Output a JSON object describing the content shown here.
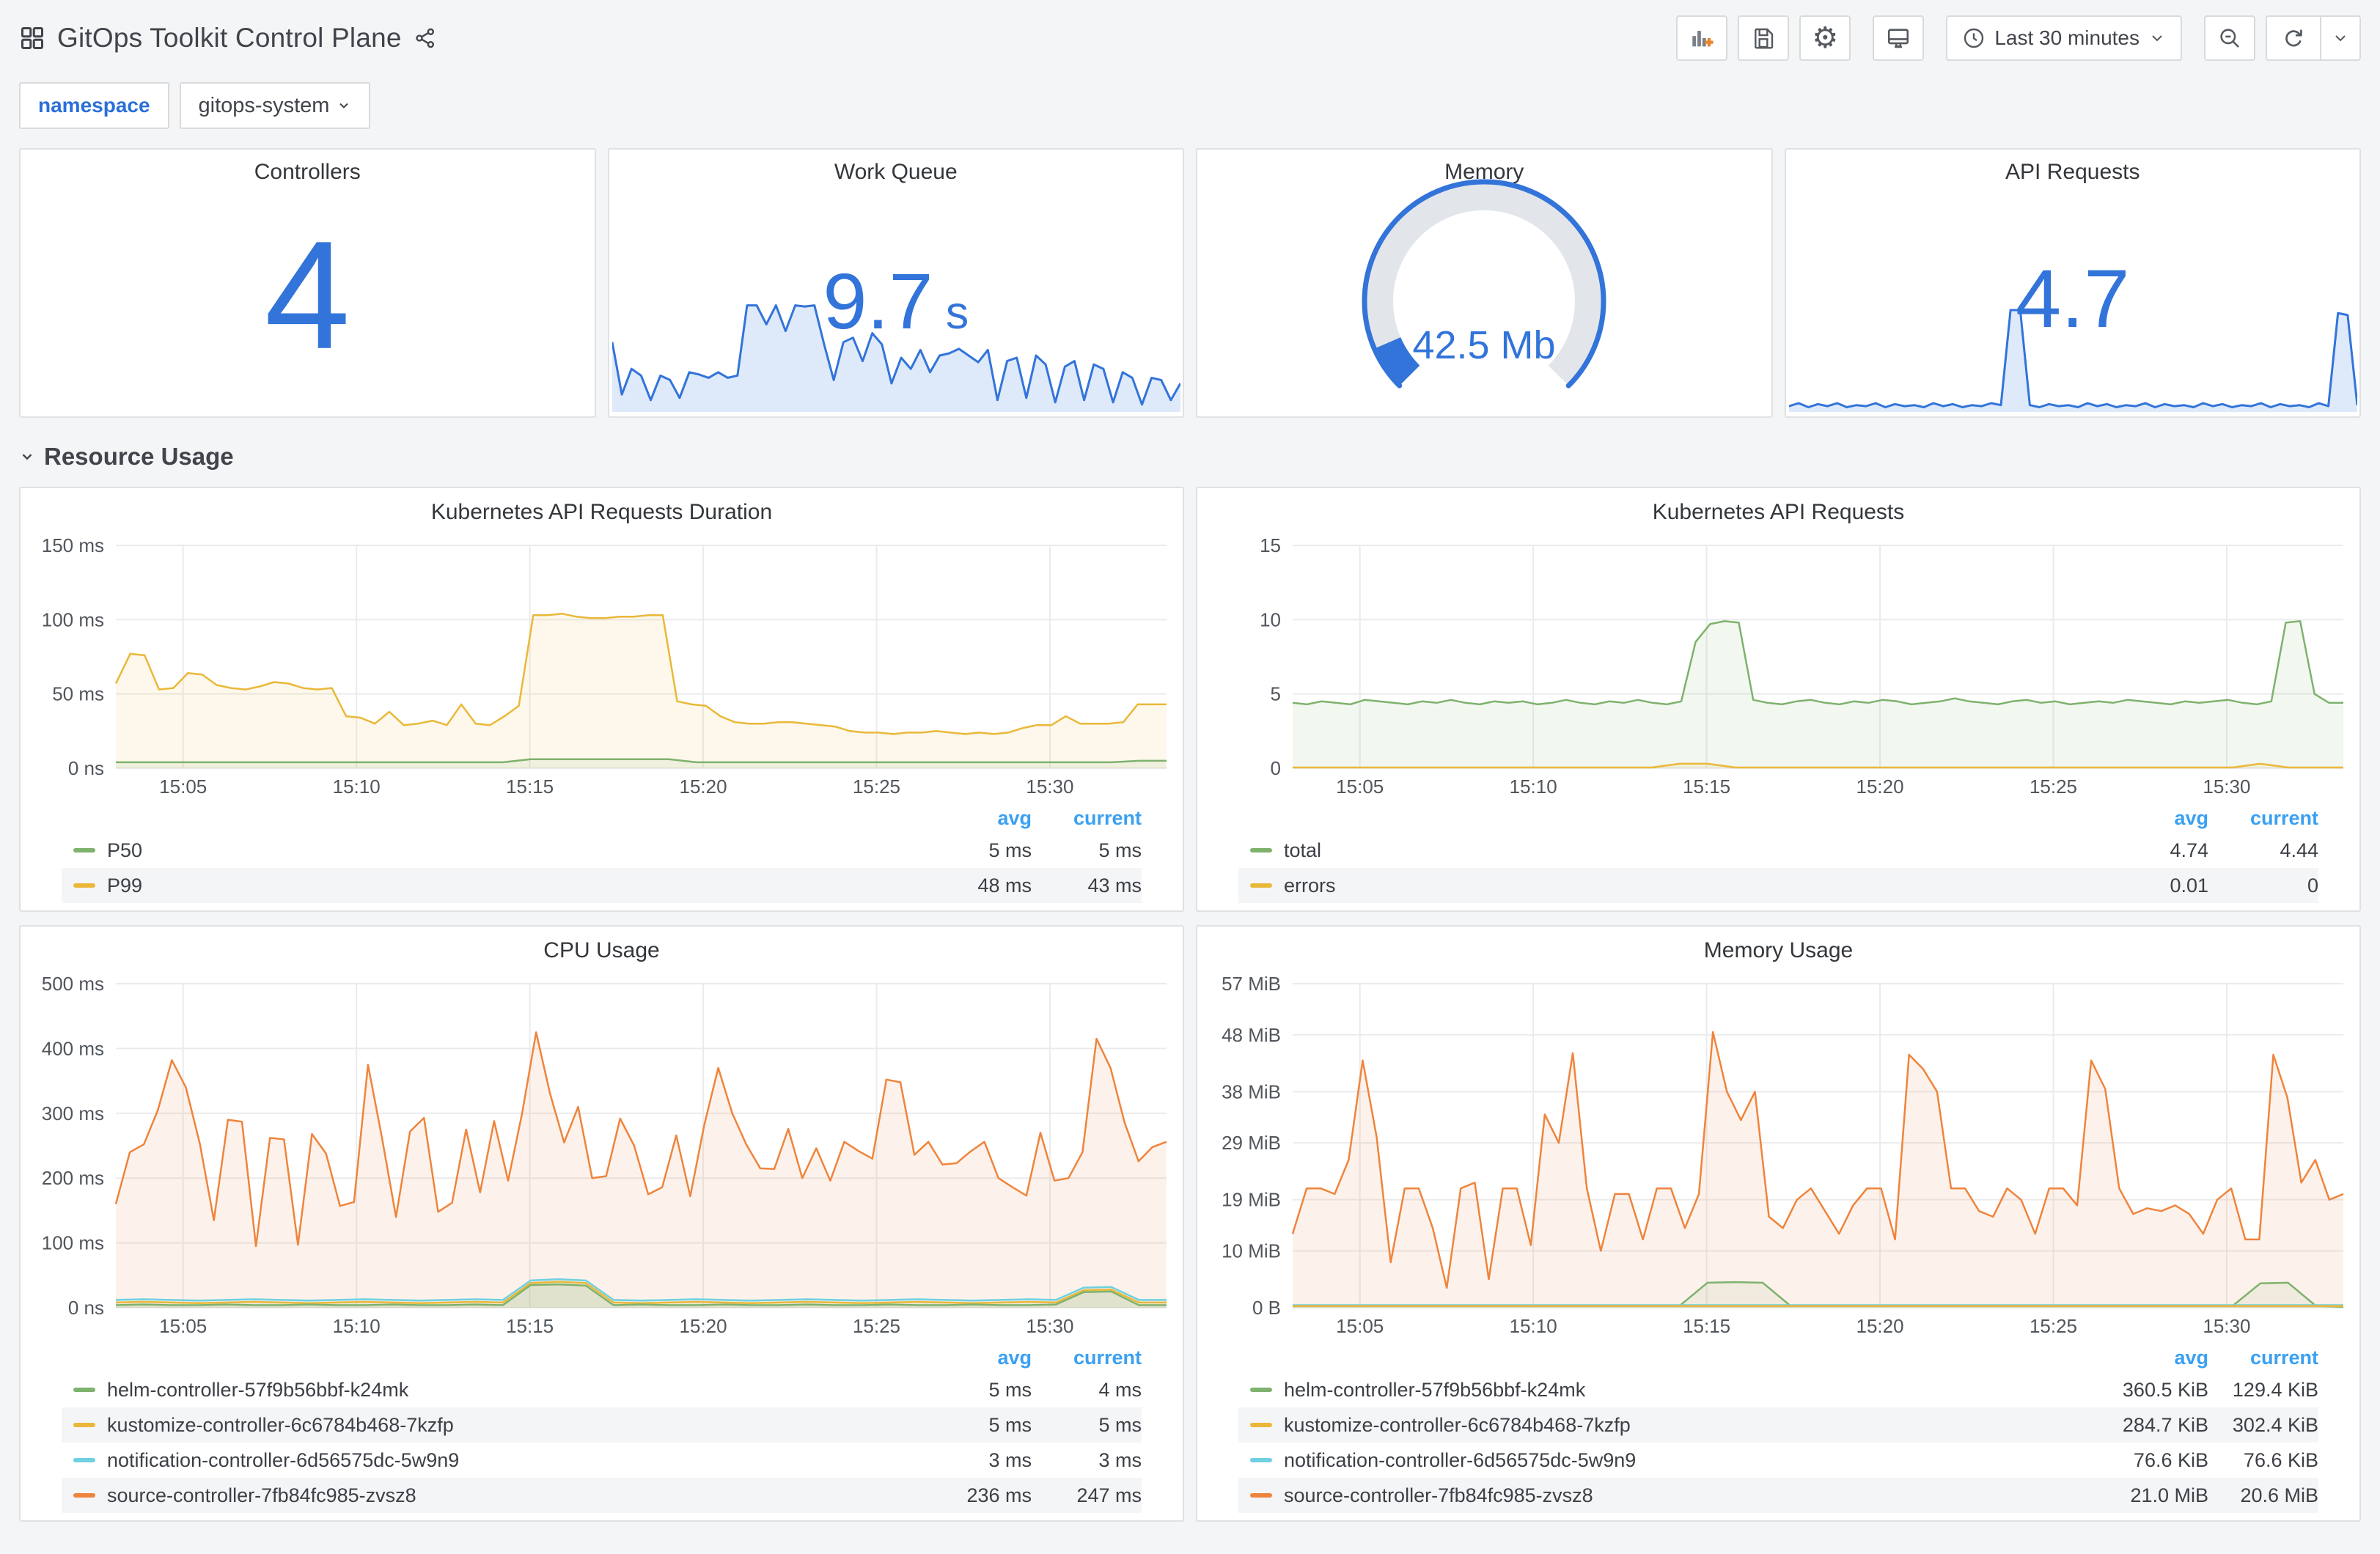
{
  "header": {
    "title": "GitOps Toolkit Control Plane",
    "time_range": "Last 30 minutes"
  },
  "toolbar": {
    "icons": [
      "add-panel",
      "save-dashboard",
      "dashboard-settings",
      "cycle-view-mode",
      "time-range",
      "zoom-out",
      "refresh",
      "refresh-interval"
    ]
  },
  "variables": {
    "label": "namespace",
    "value": "gitops-system"
  },
  "section": {
    "title": "Resource Usage"
  },
  "colors": {
    "blue": "#3274D9",
    "green": "#7EB26D",
    "yellow": "#EAB839",
    "lightblue": "#6ED0E0",
    "orange": "#EF843C"
  },
  "stats": [
    {
      "title": "Controllers",
      "value": "4"
    },
    {
      "title": "Work Queue",
      "value": "9.7",
      "suffix": " s",
      "spark": [
        0.62,
        0.15,
        0.38,
        0.32,
        0.1,
        0.32,
        0.28,
        0.12,
        0.35,
        0.33,
        0.3,
        0.35,
        0.3,
        0.32,
        0.95,
        0.95,
        0.78,
        0.95,
        0.72,
        0.95,
        0.94,
        0.95,
        0.6,
        0.28,
        0.62,
        0.66,
        0.45,
        0.7,
        0.6,
        0.25,
        0.48,
        0.38,
        0.55,
        0.35,
        0.5,
        0.52,
        0.56,
        0.5,
        0.44,
        0.55,
        0.1,
        0.45,
        0.48,
        0.12,
        0.5,
        0.42,
        0.08,
        0.4,
        0.45,
        0.1,
        0.42,
        0.38,
        0.08,
        0.35,
        0.3,
        0.06,
        0.3,
        0.28,
        0.1,
        0.25
      ]
    },
    {
      "title": "Memory",
      "value": "42.5 Mb",
      "gauge_fraction": 0.08
    },
    {
      "title": "API Requests",
      "value": "4.7",
      "spark": [
        0.05,
        0.08,
        0.04,
        0.07,
        0.05,
        0.08,
        0.04,
        0.06,
        0.05,
        0.08,
        0.04,
        0.07,
        0.05,
        0.06,
        0.04,
        0.08,
        0.05,
        0.07,
        0.04,
        0.06,
        0.05,
        0.08,
        0.06,
        1.0,
        1.0,
        0.06,
        0.04,
        0.07,
        0.05,
        0.06,
        0.04,
        0.08,
        0.05,
        0.07,
        0.04,
        0.06,
        0.05,
        0.08,
        0.04,
        0.07,
        0.05,
        0.06,
        0.04,
        0.08,
        0.05,
        0.07,
        0.04,
        0.06,
        0.05,
        0.08,
        0.04,
        0.07,
        0.05,
        0.06,
        0.04,
        0.08,
        0.05,
        0.97,
        0.95,
        0.06
      ]
    }
  ],
  "legend_cols": [
    "avg",
    "current"
  ],
  "chart_data": [
    {
      "type": "area",
      "title": "Kubernetes API Requests Duration",
      "ymax": 150,
      "yticks": [
        {
          "v": 0,
          "label": "0 ns"
        },
        {
          "v": 50,
          "label": "50 ms"
        },
        {
          "v": 100,
          "label": "100 ms"
        },
        {
          "v": 150,
          "label": "150 ms"
        }
      ],
      "xticks": [
        {
          "f": 0.064,
          "label": "15:05"
        },
        {
          "f": 0.229,
          "label": "15:10"
        },
        {
          "f": 0.394,
          "label": "15:15"
        },
        {
          "f": 0.559,
          "label": "15:20"
        },
        {
          "f": 0.724,
          "label": "15:25"
        },
        {
          "f": 0.889,
          "label": "15:30"
        }
      ],
      "series": [
        {
          "name": "P50",
          "color": "#7EB26D",
          "avg": "5 ms",
          "current": "5 ms",
          "values": [
            4,
            4,
            4,
            4,
            4,
            4,
            4,
            4,
            4,
            4,
            4,
            4,
            4,
            4,
            4,
            6,
            6,
            6,
            6,
            6,
            6,
            4,
            4,
            4,
            4,
            4,
            4,
            4,
            4,
            4,
            4,
            4,
            4,
            4,
            4,
            4,
            4,
            5,
            5
          ]
        },
        {
          "name": "P99",
          "color": "#EAB839",
          "avg": "48 ms",
          "current": "43 ms",
          "values": [
            57,
            77,
            76,
            53,
            54,
            64,
            63,
            56,
            54,
            53,
            55,
            58,
            57,
            54,
            53,
            54,
            35,
            34,
            30,
            38,
            29,
            30,
            32,
            29,
            43,
            30,
            29,
            35,
            42,
            103,
            103,
            104,
            102,
            101,
            101,
            102,
            102,
            103,
            103,
            45,
            43,
            42,
            35,
            31,
            30,
            30,
            31,
            31,
            30,
            29,
            28,
            25,
            24,
            24,
            23,
            24,
            24,
            25,
            24,
            23,
            24,
            23,
            24,
            27,
            29,
            29,
            35,
            30,
            30,
            30,
            31,
            43,
            43,
            43
          ]
        }
      ]
    },
    {
      "type": "area",
      "title": "Kubernetes API Requests",
      "ymax": 15,
      "yticks": [
        {
          "v": 0,
          "label": "0"
        },
        {
          "v": 5,
          "label": "5"
        },
        {
          "v": 10,
          "label": "10"
        },
        {
          "v": 15,
          "label": "15"
        }
      ],
      "xticks": [
        {
          "f": 0.064,
          "label": "15:05"
        },
        {
          "f": 0.229,
          "label": "15:10"
        },
        {
          "f": 0.394,
          "label": "15:15"
        },
        {
          "f": 0.559,
          "label": "15:20"
        },
        {
          "f": 0.724,
          "label": "15:25"
        },
        {
          "f": 0.889,
          "label": "15:30"
        }
      ],
      "series": [
        {
          "name": "total",
          "color": "#7EB26D",
          "avg": "4.74",
          "current": "4.44",
          "values": [
            4.4,
            4.3,
            4.5,
            4.4,
            4.3,
            4.6,
            4.5,
            4.4,
            4.3,
            4.5,
            4.4,
            4.6,
            4.4,
            4.3,
            4.5,
            4.4,
            4.5,
            4.3,
            4.4,
            4.6,
            4.4,
            4.3,
            4.5,
            4.4,
            4.6,
            4.4,
            4.3,
            4.5,
            8.5,
            9.7,
            9.9,
            9.8,
            4.6,
            4.4,
            4.3,
            4.5,
            4.6,
            4.4,
            4.3,
            4.5,
            4.4,
            4.6,
            4.5,
            4.3,
            4.4,
            4.5,
            4.7,
            4.5,
            4.4,
            4.3,
            4.5,
            4.6,
            4.4,
            4.5,
            4.3,
            4.4,
            4.5,
            4.4,
            4.6,
            4.5,
            4.4,
            4.3,
            4.5,
            4.4,
            4.5,
            4.6,
            4.4,
            4.3,
            4.5,
            9.8,
            9.9,
            5.0,
            4.4,
            4.4
          ]
        },
        {
          "name": "errors",
          "color": "#EAB839",
          "avg": "0.01",
          "current": "0",
          "values": [
            0.05,
            0.05,
            0.05,
            0.05,
            0.05,
            0.05,
            0.05,
            0.05,
            0.05,
            0.05,
            0.05,
            0.05,
            0.05,
            0.05,
            0.3,
            0.3,
            0.05,
            0.05,
            0.05,
            0.05,
            0.05,
            0.05,
            0.05,
            0.05,
            0.05,
            0.05,
            0.05,
            0.05,
            0.05,
            0.05,
            0.05,
            0.05,
            0.05,
            0.05,
            0.05,
            0.3,
            0.05,
            0.05,
            0.05
          ]
        }
      ]
    },
    {
      "type": "area",
      "title": "CPU Usage",
      "ymax": 500,
      "yticks": [
        {
          "v": 0,
          "label": "0 ns"
        },
        {
          "v": 100,
          "label": "100 ms"
        },
        {
          "v": 200,
          "label": "200 ms"
        },
        {
          "v": 300,
          "label": "300 ms"
        },
        {
          "v": 400,
          "label": "400 ms"
        },
        {
          "v": 500,
          "label": "500 ms"
        }
      ],
      "xticks": [
        {
          "f": 0.064,
          "label": "15:05"
        },
        {
          "f": 0.229,
          "label": "15:10"
        },
        {
          "f": 0.394,
          "label": "15:15"
        },
        {
          "f": 0.559,
          "label": "15:20"
        },
        {
          "f": 0.724,
          "label": "15:25"
        },
        {
          "f": 0.889,
          "label": "15:30"
        }
      ],
      "series": [
        {
          "name": "helm-controller-57f9b56bbf-k24mk",
          "color": "#7EB26D",
          "avg": "5 ms",
          "current": "4 ms",
          "values": [
            4,
            5,
            4,
            4,
            5,
            4,
            4,
            5,
            4,
            4,
            5,
            4,
            4,
            5,
            4,
            35,
            36,
            34,
            4,
            5,
            4,
            4,
            5,
            4,
            4,
            5,
            4,
            4,
            5,
            4,
            4,
            5,
            4,
            4,
            5,
            24,
            25,
            4,
            4
          ]
        },
        {
          "name": "kustomize-controller-6c6784b468-7kzfp",
          "color": "#EAB839",
          "avg": "5 ms",
          "current": "5 ms",
          "values": [
            8,
            9,
            8,
            7,
            8,
            9,
            8,
            7,
            8,
            9,
            8,
            7,
            8,
            9,
            8,
            38,
            40,
            38,
            8,
            7,
            8,
            9,
            8,
            7,
            8,
            9,
            8,
            7,
            8,
            9,
            8,
            7,
            8,
            9,
            8,
            27,
            28,
            8,
            8
          ]
        },
        {
          "name": "notification-controller-6d56575dc-5w9n9",
          "color": "#6ED0E0",
          "avg": "3 ms",
          "current": "3 ms",
          "values": [
            12,
            13,
            12,
            11,
            12,
            13,
            12,
            11,
            12,
            13,
            12,
            11,
            12,
            13,
            12,
            42,
            44,
            42,
            12,
            11,
            12,
            13,
            12,
            11,
            12,
            13,
            12,
            11,
            12,
            13,
            12,
            11,
            12,
            13,
            12,
            31,
            32,
            12,
            12
          ]
        },
        {
          "name": "source-controller-7fb84fc985-zvsz8",
          "color": "#EF843C",
          "avg": "236 ms",
          "current": "247 ms",
          "values": [
            160,
            240,
            252,
            305,
            382,
            340,
            253,
            135,
            290,
            287,
            95,
            262,
            260,
            97,
            268,
            238,
            157,
            163,
            375,
            262,
            140,
            272,
            293,
            148,
            162,
            275,
            178,
            288,
            196,
            300,
            425,
            330,
            255,
            310,
            200,
            203,
            292,
            250,
            175,
            186,
            266,
            172,
            282,
            370,
            300,
            252,
            215,
            214,
            276,
            200,
            246,
            196,
            256,
            242,
            230,
            352,
            348,
            236,
            256,
            221,
            223,
            241,
            256,
            200,
            186,
            173,
            270,
            196,
            200,
            240,
            415,
            370,
            286,
            226,
            248,
            256
          ]
        }
      ]
    },
    {
      "type": "area",
      "title": "Memory Usage",
      "ymax": 57,
      "yticks": [
        {
          "v": 0,
          "label": "0 B"
        },
        {
          "v": 10,
          "label": "10 MiB"
        },
        {
          "v": 19,
          "label": "19 MiB"
        },
        {
          "v": 29,
          "label": "29 MiB"
        },
        {
          "v": 38,
          "label": "38 MiB"
        },
        {
          "v": 48,
          "label": "48 MiB"
        },
        {
          "v": 57,
          "label": "57 MiB"
        }
      ],
      "xticks": [
        {
          "f": 0.064,
          "label": "15:05"
        },
        {
          "f": 0.229,
          "label": "15:10"
        },
        {
          "f": 0.394,
          "label": "15:15"
        },
        {
          "f": 0.559,
          "label": "15:20"
        },
        {
          "f": 0.724,
          "label": "15:25"
        },
        {
          "f": 0.889,
          "label": "15:30"
        }
      ],
      "series": [
        {
          "name": "helm-controller-57f9b56bbf-k24mk",
          "color": "#7EB26D",
          "avg": "360.5 KiB",
          "current": "129.4 KiB",
          "values": [
            0.35,
            0.35,
            0.35,
            0.35,
            0.35,
            0.35,
            0.35,
            0.35,
            0.35,
            0.35,
            0.35,
            0.35,
            0.35,
            0.35,
            0.35,
            4.4,
            4.5,
            4.4,
            0.35,
            0.35,
            0.35,
            0.35,
            0.35,
            0.35,
            0.35,
            0.35,
            0.35,
            0.35,
            0.35,
            0.35,
            0.35,
            0.35,
            0.35,
            0.35,
            0.35,
            4.3,
            4.4,
            0.35,
            0.13
          ]
        },
        {
          "name": "kustomize-controller-6c6784b468-7kzfp",
          "color": "#EAB839",
          "avg": "284.7 KiB",
          "current": "302.4 KiB",
          "values": [
            0.28,
            0.28,
            0.28,
            0.28,
            0.28,
            0.28,
            0.28,
            0.28,
            0.28,
            0.28,
            0.28,
            0.28,
            0.28,
            0.28,
            0.28,
            0.28,
            0.28,
            0.28,
            0.28,
            0.28,
            0.28,
            0.28,
            0.28,
            0.28,
            0.28,
            0.28,
            0.28,
            0.28,
            0.28,
            0.28,
            0.28,
            0.28,
            0.28,
            0.28,
            0.28,
            0.28,
            0.28,
            0.3,
            0.3
          ]
        },
        {
          "name": "notification-controller-6d56575dc-5w9n9",
          "color": "#6ED0E0",
          "avg": "76.6 KiB",
          "current": "76.6 KiB",
          "values": [
            0.45,
            0.45,
            0.45,
            0.45,
            0.45,
            0.45,
            0.45,
            0.45,
            0.45,
            0.45,
            0.45,
            0.45,
            0.45,
            0.45,
            0.45,
            0.45,
            0.45,
            0.45,
            0.45,
            0.45,
            0.45,
            0.45,
            0.45,
            0.45,
            0.45,
            0.45,
            0.45,
            0.45,
            0.45,
            0.45,
            0.45,
            0.45,
            0.45,
            0.45,
            0.45,
            0.45,
            0.45,
            0.45,
            0.45
          ]
        },
        {
          "name": "source-controller-7fb84fc985-zvsz8",
          "color": "#EF843C",
          "avg": "21.0 MiB",
          "current": "20.6 MiB",
          "values": [
            13,
            21,
            21,
            20,
            26,
            43.5,
            30,
            8,
            21,
            21,
            14,
            3.5,
            21,
            22,
            5,
            21,
            21,
            11,
            34,
            29,
            44.8,
            21,
            10,
            20,
            20,
            12,
            21,
            21,
            14,
            20,
            48.5,
            38,
            33,
            38,
            16,
            14,
            19,
            21,
            17,
            13,
            18,
            21,
            21,
            12,
            44.5,
            42,
            38,
            21,
            21,
            17,
            16,
            21,
            19,
            13,
            21,
            21,
            18,
            43.5,
            38.5,
            21,
            16.5,
            17.5,
            17,
            18,
            16.5,
            13,
            19,
            21,
            12,
            12,
            44.5,
            37,
            22,
            26,
            19,
            20
          ]
        }
      ]
    }
  ]
}
